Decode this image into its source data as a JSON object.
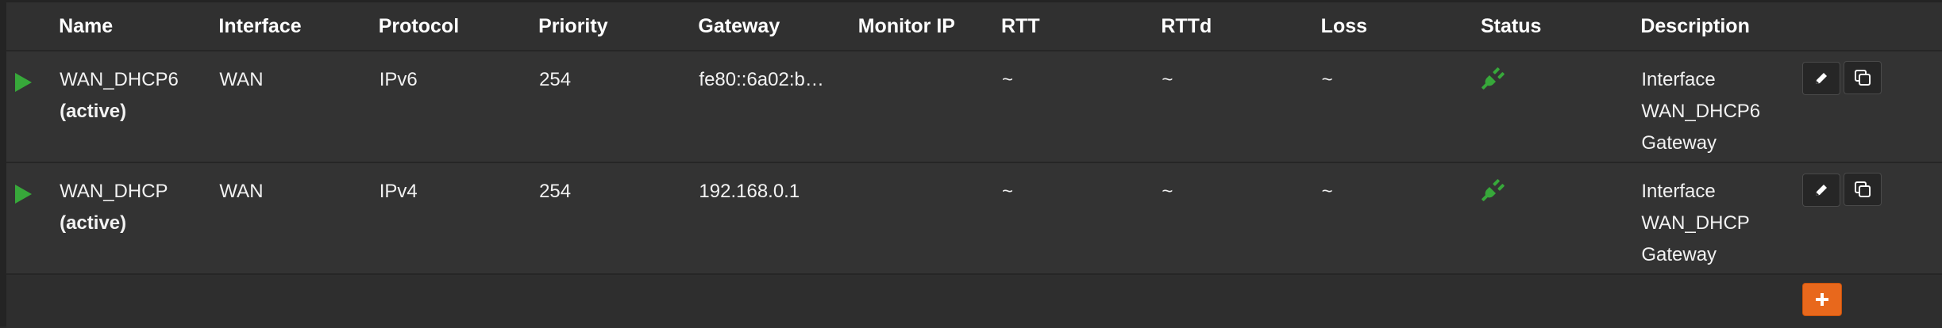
{
  "table": {
    "headers": {
      "name": "Name",
      "interface": "Interface",
      "protocol": "Protocol",
      "priority": "Priority",
      "gateway": "Gateway",
      "monitor_ip": "Monitor IP",
      "rtt": "RTT",
      "rttd": "RTTd",
      "loss": "Loss",
      "status": "Status",
      "description": "Description"
    },
    "rows": [
      {
        "name": "WAN_DHCP6",
        "state": "(active)",
        "interface": "WAN",
        "protocol": "IPv6",
        "priority": "254",
        "gateway": "fe80::6a02:b…",
        "monitor_ip": "",
        "rtt": "~",
        "rttd": "~",
        "loss": "~",
        "status_icon": "plug-icon",
        "description": [
          "Interface",
          "WAN_DHCP6",
          "Gateway"
        ]
      },
      {
        "name": "WAN_DHCP",
        "state": "(active)",
        "interface": "WAN",
        "protocol": "IPv4",
        "priority": "254",
        "gateway": "192.168.0.1",
        "monitor_ip": "",
        "rtt": "~",
        "rttd": "~",
        "loss": "~",
        "status_icon": "plug-icon",
        "description": [
          "Interface",
          "WAN_DHCP",
          "Gateway"
        ]
      }
    ]
  },
  "colors": {
    "status_online": "#37a83a",
    "add_button": "#e8681c",
    "background": "#303030"
  },
  "icons": {
    "row_toggle": "play-icon",
    "edit": "pencil-icon",
    "clone": "copy-icon",
    "add": "plus-icon"
  }
}
